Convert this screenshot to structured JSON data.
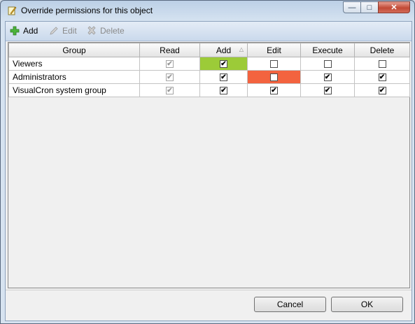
{
  "window": {
    "title": "Override permissions for this object"
  },
  "toolbar": {
    "add": "Add",
    "edit": "Edit",
    "delete": "Delete"
  },
  "grid": {
    "columns": [
      "Group",
      "Read",
      "Add",
      "Edit",
      "Execute",
      "Delete"
    ],
    "rows": [
      {
        "group": "Viewers",
        "read": true,
        "add": true,
        "edit": false,
        "execute": false,
        "delete": false
      },
      {
        "group": "Administrators",
        "read": true,
        "add": true,
        "edit": false,
        "execute": true,
        "delete": true
      },
      {
        "group": "VisualCron system group",
        "read": true,
        "add": true,
        "edit": true,
        "execute": true,
        "delete": true
      }
    ]
  },
  "buttons": {
    "cancel": "Cancel",
    "ok": "OK"
  },
  "colors": {
    "modified_on": "#9ccb38",
    "modified_off": "#f3633f"
  }
}
